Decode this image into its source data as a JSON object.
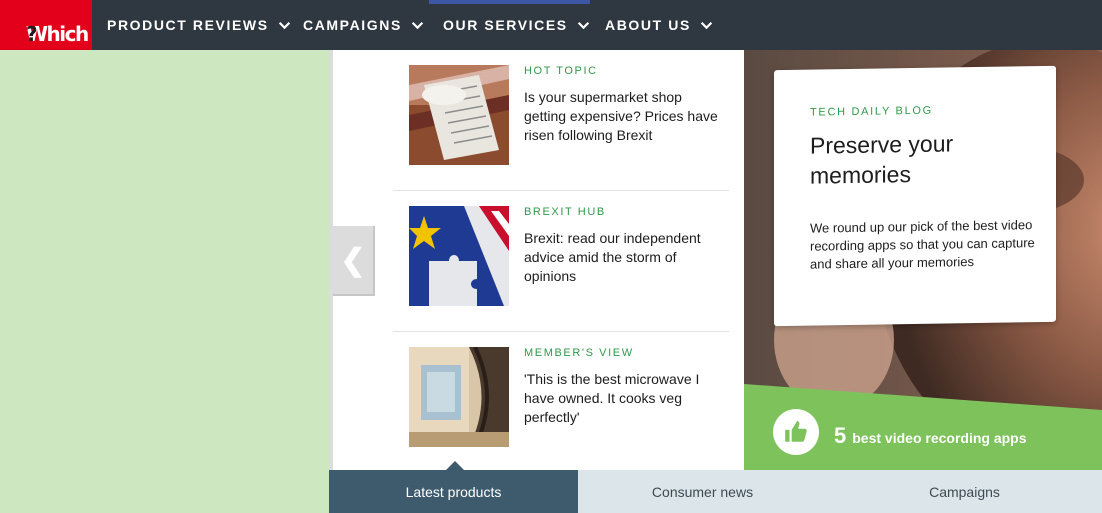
{
  "logo": {
    "text": "Which",
    "mark": "?"
  },
  "nav": {
    "items": [
      {
        "label": "PRODUCT REVIEWS"
      },
      {
        "label": "CAMPAIGNS"
      },
      {
        "label": "OUR SERVICES"
      },
      {
        "label": "ABOUT US"
      }
    ],
    "chevron_icon": "chevron-down-icon",
    "active_color": "#3c58a4"
  },
  "carousel": {
    "prev_glyph": "❮",
    "cards": [
      {
        "kicker": "HOT TOPIC",
        "headline": "Is your supermarket shop getting expensive? Prices have risen following Brexit"
      },
      {
        "kicker": "BREXIT HUB",
        "headline": "Brexit: read our independent advice amid the storm of opinions"
      },
      {
        "kicker": "MEMBER'S VIEW",
        "headline": "'This is the best microwave I have owned. It cooks veg perfectly'"
      }
    ]
  },
  "hero": {
    "kicker": "TECH DAILY BLOG",
    "title": "Preserve your memories",
    "description": "We round up our pick of the best video recording apps so that you can capture and share all your memories",
    "promo_number": "5",
    "promo_label": "best video recording apps",
    "promo_color": "#7dc25a"
  },
  "tabs": [
    {
      "label": "Latest products"
    },
    {
      "label": "Consumer news"
    },
    {
      "label": "Campaigns"
    }
  ],
  "colors": {
    "brand_red": "#e3001b",
    "nav_bg": "#2f3740",
    "accent_green": "#2f9a4a",
    "side_green": "#cde8c0"
  }
}
